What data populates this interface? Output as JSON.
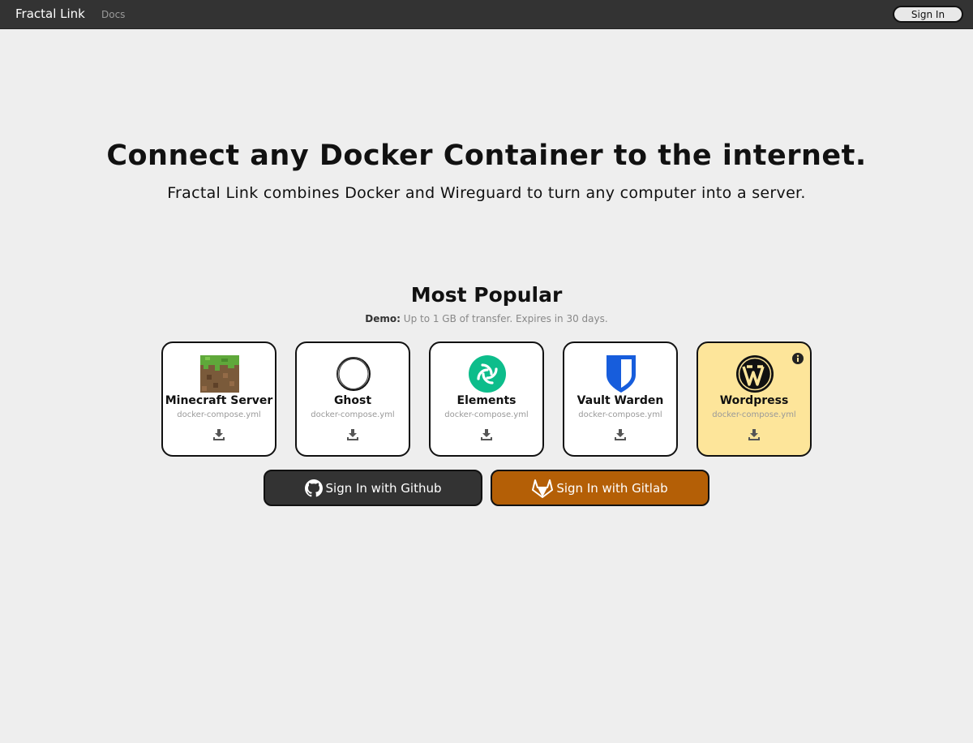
{
  "nav": {
    "brand": "Fractal Link",
    "docs": "Docs",
    "sign_in": "Sign In"
  },
  "hero": {
    "title": "Connect any Docker Container to the internet.",
    "subtitle": "Fractal Link combines Docker and Wireguard to turn any computer into a server."
  },
  "popular": {
    "title": "Most Popular",
    "demo_label": "Demo:",
    "demo_text": "Up to 1 GB of transfer. Expires in 30 days.",
    "cards": [
      {
        "name": "Minecraft Server",
        "file": "docker-compose.yml",
        "icon": "minecraft-grass-block-icon"
      },
      {
        "name": "Ghost",
        "file": "docker-compose.yml",
        "icon": "ghost-logo-icon"
      },
      {
        "name": "Elements",
        "file": "docker-compose.yml",
        "icon": "element-logo-icon"
      },
      {
        "name": "Vault Warden",
        "file": "docker-compose.yml",
        "icon": "bitwarden-shield-icon"
      },
      {
        "name": "Wordpress",
        "file": "docker-compose.yml",
        "icon": "wordpress-logo-icon",
        "featured": true
      }
    ]
  },
  "auth": {
    "github": "Sign In with Github",
    "gitlab": "Sign In with Gitlab"
  },
  "colors": {
    "navbar": "#333333",
    "background": "#eeeeee",
    "featured_card": "#fde59a",
    "github_button": "#333333",
    "gitlab_button": "#b45f06",
    "element_green": "#0dbd8b",
    "bitwarden_blue": "#175ddc"
  }
}
